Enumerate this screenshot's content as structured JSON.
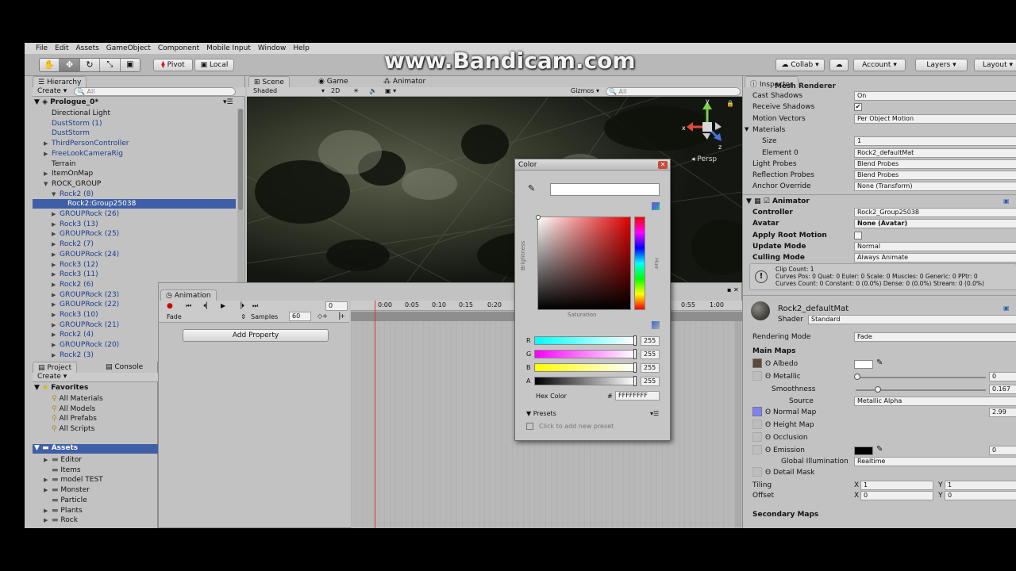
{
  "watermark": "www.Bandicam.com",
  "menu": [
    "File",
    "Edit",
    "Assets",
    "GameObject",
    "Component",
    "Mobile Input",
    "Window",
    "Help"
  ],
  "toolbar": {
    "pivot": "Pivot",
    "local": "Local",
    "collab": "Collab",
    "account": "Account",
    "layers": "Layers",
    "layout": "Layout"
  },
  "hierarchy": {
    "tab": "Hierarchy",
    "create": "Create",
    "search": "All",
    "scene": "Prologue_0*",
    "items": [
      {
        "label": "Directional Light",
        "indent": 1,
        "arrow": "",
        "blue": false
      },
      {
        "label": "DustStorm (1)",
        "indent": 1,
        "arrow": "",
        "blue": true
      },
      {
        "label": "DustStorm",
        "indent": 1,
        "arrow": "",
        "blue": true
      },
      {
        "label": "ThirdPersonController",
        "indent": 1,
        "arrow": "▶",
        "blue": true
      },
      {
        "label": "FreeLookCameraRig",
        "indent": 1,
        "arrow": "▶",
        "blue": true
      },
      {
        "label": "Terrain",
        "indent": 1,
        "arrow": "",
        "blue": false
      },
      {
        "label": "ItemOnMap",
        "indent": 1,
        "arrow": "▶",
        "blue": false
      },
      {
        "label": "ROCK_GROUP",
        "indent": 1,
        "arrow": "▼",
        "blue": false
      },
      {
        "label": "Rock2 (8)",
        "indent": 2,
        "arrow": "▼",
        "blue": true
      },
      {
        "label": "Rock2:Group25038",
        "indent": 3,
        "arrow": "",
        "blue": true,
        "selected": true
      },
      {
        "label": "GROUPRock (26)",
        "indent": 2,
        "arrow": "▶",
        "blue": true
      },
      {
        "label": "Rock3 (13)",
        "indent": 2,
        "arrow": "▶",
        "blue": true
      },
      {
        "label": "GROUPRock (25)",
        "indent": 2,
        "arrow": "▶",
        "blue": true
      },
      {
        "label": "Rock2 (7)",
        "indent": 2,
        "arrow": "▶",
        "blue": true
      },
      {
        "label": "GROUPRock (24)",
        "indent": 2,
        "arrow": "▶",
        "blue": true
      },
      {
        "label": "Rock3 (12)",
        "indent": 2,
        "arrow": "▶",
        "blue": true
      },
      {
        "label": "Rock3 (11)",
        "indent": 2,
        "arrow": "▶",
        "blue": true
      },
      {
        "label": "Rock2 (6)",
        "indent": 2,
        "arrow": "▶",
        "blue": true
      },
      {
        "label": "GROUPRock (23)",
        "indent": 2,
        "arrow": "▶",
        "blue": true
      },
      {
        "label": "GROUPRock (22)",
        "indent": 2,
        "arrow": "▶",
        "blue": true
      },
      {
        "label": "Rock3 (10)",
        "indent": 2,
        "arrow": "▶",
        "blue": true
      },
      {
        "label": "GROUPRock (21)",
        "indent": 2,
        "arrow": "▶",
        "blue": true
      },
      {
        "label": "Rock2 (4)",
        "indent": 2,
        "arrow": "▶",
        "blue": true
      },
      {
        "label": "GROUPRock (20)",
        "indent": 2,
        "arrow": "▶",
        "blue": true
      },
      {
        "label": "Rock2 (3)",
        "indent": 2,
        "arrow": "▶",
        "blue": true
      }
    ]
  },
  "project": {
    "tabs": [
      "Project",
      "Console"
    ],
    "create": "Create",
    "favorites": "Favorites",
    "fav_items": [
      "All Materials",
      "All Models",
      "All Prefabs",
      "All Scripts"
    ],
    "assets": "Assets",
    "folders": [
      {
        "label": "Editor",
        "arrow": "▶"
      },
      {
        "label": "Items",
        "arrow": ""
      },
      {
        "label": "model TEST",
        "arrow": "▶"
      },
      {
        "label": "Monster",
        "arrow": "▶"
      },
      {
        "label": "Particle",
        "arrow": ""
      },
      {
        "label": "Plants",
        "arrow": "▶"
      },
      {
        "label": "Rock",
        "arrow": "▶"
      }
    ]
  },
  "scene": {
    "tabs": [
      "Scene",
      "Game",
      "Animator"
    ],
    "shaded": "Shaded",
    "two_d": "2D",
    "gizmos": "Gizmos",
    "search": "All",
    "persp": "Persp"
  },
  "animation": {
    "tab": "Animation",
    "clip": "Fade",
    "samples_label": "Samples",
    "samples": "60",
    "frame": "0",
    "add_property": "Add Property",
    "ticks": [
      "0:00",
      "0:05",
      "0:10",
      "0:15",
      "0:20",
      "0:55",
      "1:00"
    ]
  },
  "color_picker": {
    "title": "Color",
    "brightness": "Brightness",
    "saturation": "Saturation",
    "hue": "Hue",
    "channels": [
      {
        "name": "R",
        "value": "255"
      },
      {
        "name": "G",
        "value": "255"
      },
      {
        "name": "B",
        "value": "255"
      },
      {
        "name": "A",
        "value": "255"
      }
    ],
    "hex_label": "Hex Color",
    "hex_hash": "#",
    "hex_value": "FFFFFFFF",
    "presets": "Presets",
    "add_preset": "Click to add new preset"
  },
  "inspector": {
    "tab": "Inspector",
    "mesh_renderer": "Mesh Renderer",
    "mesh_props": [
      {
        "label": "Cast Shadows",
        "value": "On"
      },
      {
        "label": "Receive Shadows",
        "value": "✔"
      },
      {
        "label": "Motion Vectors",
        "value": "Per Object Motion"
      },
      {
        "label": "Materials",
        "value": ""
      },
      {
        "label": "Size",
        "value": "1"
      },
      {
        "label": "Element 0",
        "value": "Rock2_defaultMat"
      },
      {
        "label": "Light Probes",
        "value": "Blend Probes"
      },
      {
        "label": "Reflection Probes",
        "value": "Blend Probes"
      },
      {
        "label": "Anchor Override",
        "value": "None (Transform)"
      }
    ],
    "animator": "Animator",
    "animator_props": [
      {
        "label": "Controller",
        "value": "Rock2_Group25038"
      },
      {
        "label": "Avatar",
        "value": "None (Avatar)"
      },
      {
        "label": "Apply Root Motion",
        "value": ""
      },
      {
        "label": "Update Mode",
        "value": "Normal"
      },
      {
        "label": "Culling Mode",
        "value": "Always Animate"
      }
    ],
    "clip_info": [
      "Clip Count: 1",
      "Curves Pos: 0 Quat: 0 Euler: 0 Scale: 0 Muscles: 0 Generic: 0 PPtr: 0",
      "Curves Count: 0 Constant: 0 (0.0%) Dense: 0 (0.0%) Stream: 0 (0.0%)"
    ],
    "material": "Rock2_defaultMat",
    "shader_label": "Shader",
    "shader": "Standard",
    "rendering_mode_label": "Rendering Mode",
    "rendering_mode": "Fade",
    "main_maps": "Main Maps",
    "albedo": "Albedo",
    "metallic": "Metallic",
    "metallic_value": "0",
    "smoothness": "Smoothness",
    "smoothness_value": "0.167",
    "source": "Source",
    "source_value": "Metallic Alpha",
    "normal_map": "Normal Map",
    "normal_value": "2.99",
    "height_map": "Height Map",
    "occlusion": "Occlusion",
    "emission": "Emission",
    "emission_value": "0",
    "gi_label": "Global Illumination",
    "gi_value": "Realtime",
    "detail_mask": "Detail Mask",
    "tiling": "Tiling",
    "offset": "Offset",
    "tiling_x": "1",
    "tiling_y": "1",
    "offset_x": "0",
    "offset_y": "0",
    "x": "X",
    "y": "Y",
    "secondary_maps": "Secondary Maps"
  }
}
